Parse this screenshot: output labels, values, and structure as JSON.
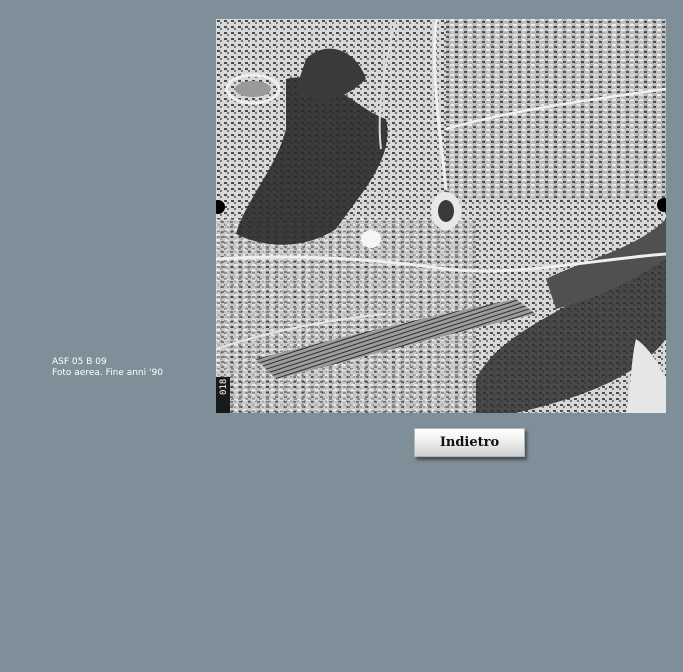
{
  "caption": {
    "line1": "ASF 05 B 09",
    "line2": "Foto aerea. Fine anni '90"
  },
  "photo": {
    "alt": "",
    "frame_label": "018"
  },
  "back_button": {
    "label": "Indietro"
  },
  "colors": {
    "background": "#7f8f99",
    "button_text": "#111111"
  }
}
